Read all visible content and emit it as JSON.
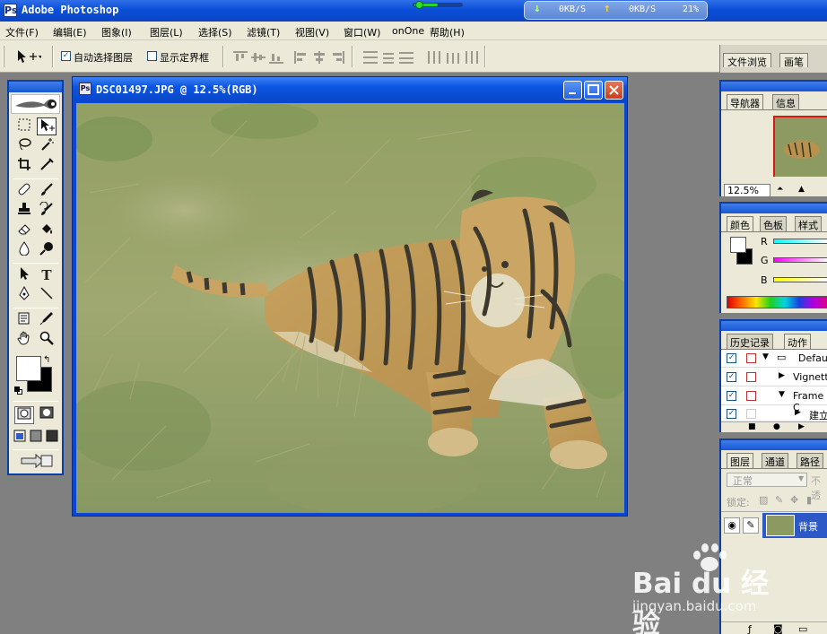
{
  "app": {
    "title": "Adobe Photoshop",
    "icon": "photoshop-icon"
  },
  "net_monitor": {
    "down": "0KB/S",
    "up": "0KB/S",
    "cpu": "21%"
  },
  "menu": [
    "文件(F)",
    "编辑(E)",
    "图象(I)",
    "图层(L)",
    "选择(S)",
    "滤镜(T)",
    "视图(V)",
    "窗口(W)",
    "onOne",
    "帮助(H)"
  ],
  "options": {
    "auto_select_label": "自动选择图层",
    "auto_select_checked": true,
    "show_bounds_label": "显示定界框",
    "show_bounds_checked": false
  },
  "palette_well": {
    "tab1": "文件浏览",
    "tab2": "画笔"
  },
  "document": {
    "title": "DSC01497.JPG @ 12.5%(RGB)"
  },
  "navigator": {
    "tab1": "导航器",
    "tab2": "信息",
    "zoom": "12.5%"
  },
  "color": {
    "tab1": "颜色",
    "tab2": "色板",
    "tab3": "样式",
    "r_label": "R",
    "g_label": "G",
    "b_label": "B"
  },
  "history": {
    "tab1": "历史记录",
    "tab2": "动作",
    "items": [
      "Defau",
      "Vignett",
      "Frame C",
      "建立"
    ]
  },
  "layers": {
    "tab1": "图层",
    "tab2": "通道",
    "tab3": "路径",
    "blend_mode": "正常",
    "opacity_label": "不透",
    "lock_label": "锁定:",
    "layer_name": "背景"
  },
  "watermark": {
    "brand": "Bai du 经验",
    "url": "jingyan.baidu.com"
  },
  "colors": {
    "title_blue": "#0b4fd9",
    "chrome": "#ece9d8",
    "workspace": "#808080",
    "close_red": "#c8401f"
  }
}
